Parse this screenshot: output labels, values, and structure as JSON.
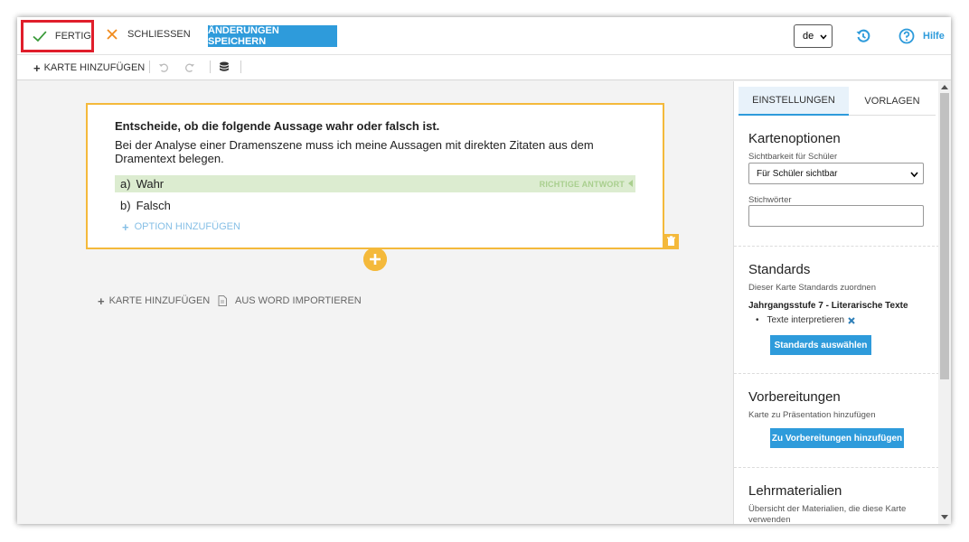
{
  "topbar": {
    "done_label": "FERTIG",
    "close_label": "SCHLIESSEN",
    "save_label": "ÄNDERUNGEN SPEICHERN",
    "language_value": "de",
    "help_label": "Hilfe"
  },
  "toolbar": {
    "add_card_label": "KARTE HINZUFÜGEN"
  },
  "card": {
    "question_title": "Entscheide, ob die folgende Aussage wahr oder falsch ist.",
    "question_text": "Bei der Analyse einer Dramenszene muss ich meine Aussagen mit direkten Zitaten aus dem Dramentext belegen.",
    "options": [
      {
        "letter": "a)",
        "text": "Wahr",
        "correct": true
      },
      {
        "letter": "b)",
        "text": "Falsch",
        "correct": false
      }
    ],
    "correct_label": "RICHTIGE ANTWORT",
    "add_option_label": "OPTION HINZUFÜGEN"
  },
  "canvas_actions": {
    "add_card_label": "KARTE HINZUFÜGEN",
    "import_word_label": "AUS WORD IMPORTIEREN"
  },
  "panel": {
    "tabs": [
      "EINSTELLUNGEN",
      "VORLAGEN"
    ],
    "card_options": {
      "title": "Kartenoptionen",
      "visibility_label": "Sichtbarkeit für Schüler",
      "visibility_value": "Für Schüler sichtbar",
      "keywords_label": "Stichwörter",
      "keywords_value": ""
    },
    "standards": {
      "title": "Standards",
      "subtitle": "Dieser Karte Standards zuordnen",
      "group": "Jahrgangsstufe 7 - Literarische Texte",
      "items": [
        "Texte interpretieren"
      ],
      "button": "Standards auswählen"
    },
    "preparations": {
      "title": "Vorbereitungen",
      "subtitle": "Karte zu Präsentation hinzufügen",
      "button": "Zu Vorbereitungen hinzufügen"
    },
    "materials": {
      "title": "Lehrmaterialien",
      "subtitle": "Übersicht der Materialien, die diese Karte verwenden"
    }
  },
  "colors": {
    "accent_blue": "#2e9bdb",
    "card_border": "#f4b93b",
    "correct_bg": "#dcecd0",
    "highlight_red": "#e01e2b"
  }
}
